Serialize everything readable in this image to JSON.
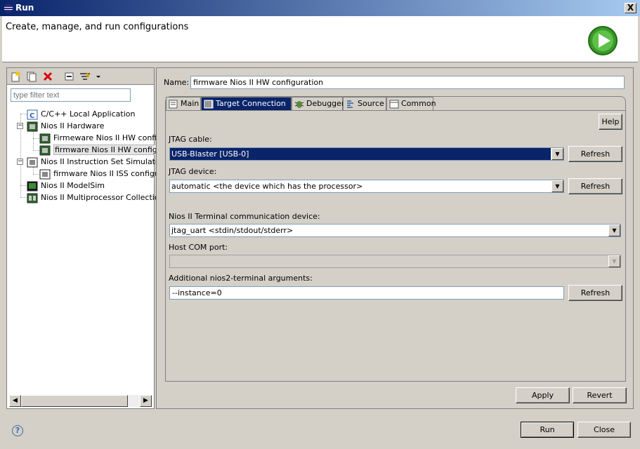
{
  "window": {
    "title": "Run",
    "close_glyph": "X"
  },
  "header": {
    "title": "Create, manage, and run configurations"
  },
  "left": {
    "filter_placeholder": "type filter text",
    "tree": [
      {
        "label": "C/C++ Local Application",
        "icon": "c-app-icon"
      },
      {
        "label": "Nios II Hardware",
        "icon": "nios-hw-icon"
      },
      {
        "label": "Firmeware Nios II HW configu",
        "icon": "nios-hw-config-icon"
      },
      {
        "label": "firmware Nios II HW configur",
        "icon": "nios-hw-config-icon"
      },
      {
        "label": "Nios II Instruction Set Simulator",
        "icon": "iss-icon"
      },
      {
        "label": "firmware Nios II ISS configur",
        "icon": "iss-config-icon"
      },
      {
        "label": "Nios II ModelSim",
        "icon": "modelsim-icon"
      },
      {
        "label": "Nios II Multiprocessor Collection",
        "icon": "multiprocessor-icon"
      }
    ]
  },
  "config": {
    "name_label": "Name:",
    "name_value": "firmware Nios II HW configuration",
    "tabs": [
      {
        "label": "Main"
      },
      {
        "label": "Target Connection"
      },
      {
        "label": "Debugger"
      },
      {
        "label": "Source"
      },
      {
        "label": "Common"
      }
    ],
    "help_label": "Help",
    "jtag_cable_label": "JTAG cable:",
    "jtag_cable_value": "USB-Blaster [USB-0]",
    "jtag_device_label": "JTAG device:",
    "jtag_device_value": "automatic <the device which has the processor>",
    "terminal_label": "Nios II Terminal communication device:",
    "terminal_value": "jtag_uart <stdin/stdout/stderr>",
    "host_com_label": "Host COM port:",
    "host_com_value": "",
    "args_label": "Additional nios2-terminal arguments:",
    "args_value": "--instance=0",
    "refresh_label": "Refresh",
    "apply_label": "Apply",
    "revert_label": "Revert"
  },
  "footer": {
    "run_label": "Run",
    "close_label": "Close",
    "help_glyph": "?"
  },
  "colors": {
    "selection": "#0a246a",
    "titlebar": "#0a246a",
    "face": "#d4d0c8"
  }
}
